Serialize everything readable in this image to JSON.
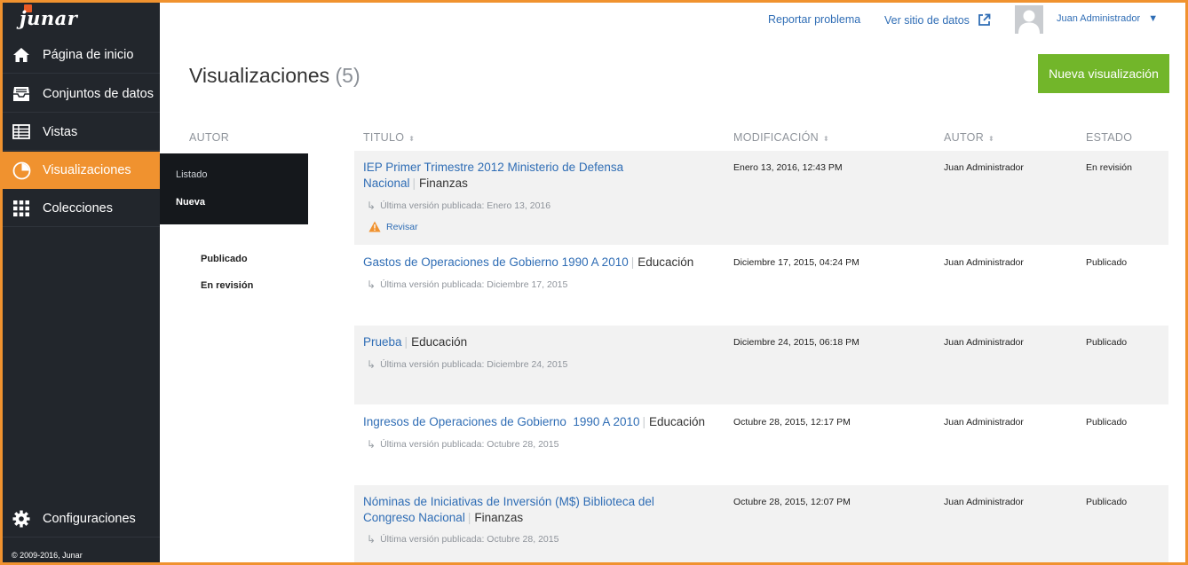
{
  "brand": {
    "logo_text": "junar"
  },
  "topbar": {
    "report_link": "Reportar problema",
    "site_link": "Ver sitio de datos",
    "user_name": "Juan Administrador",
    "user_caret": "▼"
  },
  "sidebar": {
    "items": [
      {
        "label": "Página de inicio",
        "icon": "home-icon"
      },
      {
        "label": "Conjuntos de datos",
        "icon": "inbox-icon"
      },
      {
        "label": "Vistas",
        "icon": "table-icon"
      },
      {
        "label": "Visualizaciones",
        "icon": "pie-chart-icon"
      },
      {
        "label": "Colecciones",
        "icon": "grid-icon"
      }
    ],
    "settings_label": "Configuraciones",
    "copyright": "© 2009-2016, Junar",
    "submenu": {
      "item_list": "Listado",
      "item_new": "Nueva"
    }
  },
  "page": {
    "title": "Visualizaciones",
    "count": "(5)",
    "new_button": "Nueva visualización"
  },
  "filters": {
    "author_header": "AUTOR",
    "states": [
      "Publicado",
      "En revisión"
    ]
  },
  "table": {
    "headers": {
      "title": "TITULO",
      "modified": "MODIFICACIÓN",
      "author": "AUTOR",
      "state": "ESTADO"
    },
    "review_label": "Revisar",
    "rows": [
      {
        "title": "IEP Primer Trimestre 2012 Ministerio de Defensa Nacional",
        "category": "Finanzas",
        "published": "Última versión publicada: Enero 13, 2016",
        "modified": "Enero 13, 2016, 12:43 PM",
        "author": "Juan Administrador",
        "state": "En revisión"
      },
      {
        "title": "Gastos de Operaciones de Gobierno 1990 A 2010",
        "category": "Educación",
        "published": "Última versión publicada: Diciembre 17, 2015",
        "modified": "Diciembre 17, 2015, 04:24 PM",
        "author": "Juan Administrador",
        "state": "Publicado"
      },
      {
        "title": "Prueba",
        "category": "Educación",
        "published": "Última versión publicada: Diciembre 24, 2015",
        "modified": "Diciembre 24, 2015, 06:18 PM",
        "author": "Juan Administrador",
        "state": "Publicado"
      },
      {
        "title": "Ingresos de Operaciones de Gobierno  1990 A 2010",
        "category": "Educación",
        "published": "Última versión publicada: Octubre 28, 2015",
        "modified": "Octubre 28, 2015, 12:17 PM",
        "author": "Juan Administrador",
        "state": "Publicado"
      },
      {
        "title": "Nóminas de Iniciativas de Inversión (M$) Biblioteca del Congreso Nacional",
        "category": "Finanzas",
        "published": "Última versión publicada: Octubre 28, 2015",
        "modified": "Octubre 28, 2015, 12:07 PM",
        "author": "Juan Administrador",
        "state": "Publicado"
      }
    ]
  },
  "colors": {
    "accent": "#f0922f",
    "sidebar": "#22262c",
    "link": "#2f6db5",
    "button": "#72b62a",
    "warning": "#f0922f"
  }
}
